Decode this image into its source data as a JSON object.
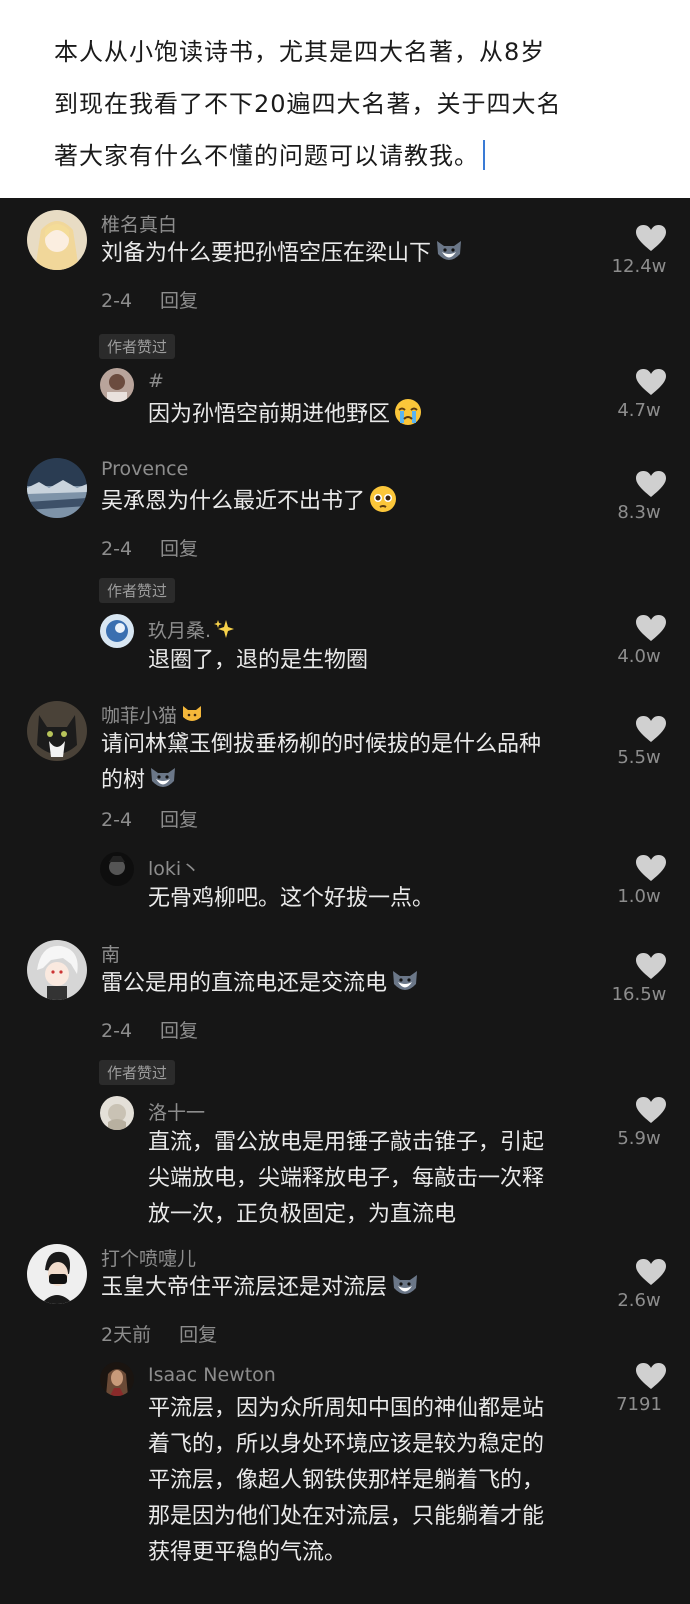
{
  "post": {
    "lines": [
      "本人从小饱读诗书，尤其是四大名著，从8岁",
      "到现在我看了不下20遍四大名著，关于四大名",
      "著大家有什么不懂的问题可以请教我。"
    ]
  },
  "colors": {
    "background": "#161616",
    "text": "#eaeaea",
    "muted": "#8d8d8d",
    "heart": "#d0d0d0"
  },
  "comments": [
    {
      "user": "椎名真白",
      "lines": [
        "刘备为什么要把孙悟空压在梁山下"
      ],
      "emoji": "wolf-emoji-icon",
      "date": "2-4",
      "reply": "回复",
      "badge": "作者赞过",
      "likes": "12.4w"
    },
    {
      "user": "#",
      "lines": [
        "因为孙悟空前期进他野区"
      ],
      "emoji": "crying-emoji-icon",
      "likes": "4.7w"
    },
    {
      "user": "Provence",
      "lines": [
        "吴承恩为什么最近不出书了"
      ],
      "emoji": "pleading-emoji-icon",
      "date": "2-4",
      "reply": "回复",
      "badge": "作者赞过",
      "likes": "8.3w"
    },
    {
      "user": "玖月桑.",
      "user_emoji": "sparkles-icon",
      "lines": [
        "退圈了，退的是生物圈"
      ],
      "likes": "4.0w"
    },
    {
      "user": "咖菲小猫",
      "user_emoji": "cat-face-icon",
      "lines": [
        "请问林黛玉倒拔垂杨柳的时候拔的是什么品种",
        "的树"
      ],
      "emoji": "wolf-emoji-icon",
      "date": "2-4",
      "reply": "回复",
      "likes": "5.5w"
    },
    {
      "user": "loki丶",
      "lines": [
        "无骨鸡柳吧。这个好拔一点。"
      ],
      "likes": "1.0w"
    },
    {
      "user": "南",
      "lines": [
        "雷公是用的直流电还是交流电"
      ],
      "emoji": "wolf-emoji-icon",
      "date": "2-4",
      "reply": "回复",
      "badge": "作者赞过",
      "likes": "16.5w"
    },
    {
      "user": "洛十一",
      "lines": [
        "直流，雷公放电是用锤子敲击锥子，引起",
        "尖端放电，尖端释放电子，每敲击一次释",
        "放一次，正负极固定，为直流电"
      ],
      "likes": "5.9w"
    },
    {
      "user": "打个喷嚏儿",
      "lines": [
        "玉皇大帝住平流层还是对流层"
      ],
      "emoji": "wolf-emoji-icon",
      "date": "2天前",
      "reply": "回复",
      "likes": "2.6w"
    },
    {
      "user": "Isaac Newton",
      "lines": [
        "平流层，因为众所周知中国的神仙都是站",
        "着飞的，所以身处环境应该是较为稳定的",
        "平流层，像超人钢铁侠那样是躺着飞的，",
        "那是因为他们处在对流层，只能躺着才能",
        "获得更平稳的气流。"
      ],
      "likes": "7191"
    }
  ]
}
